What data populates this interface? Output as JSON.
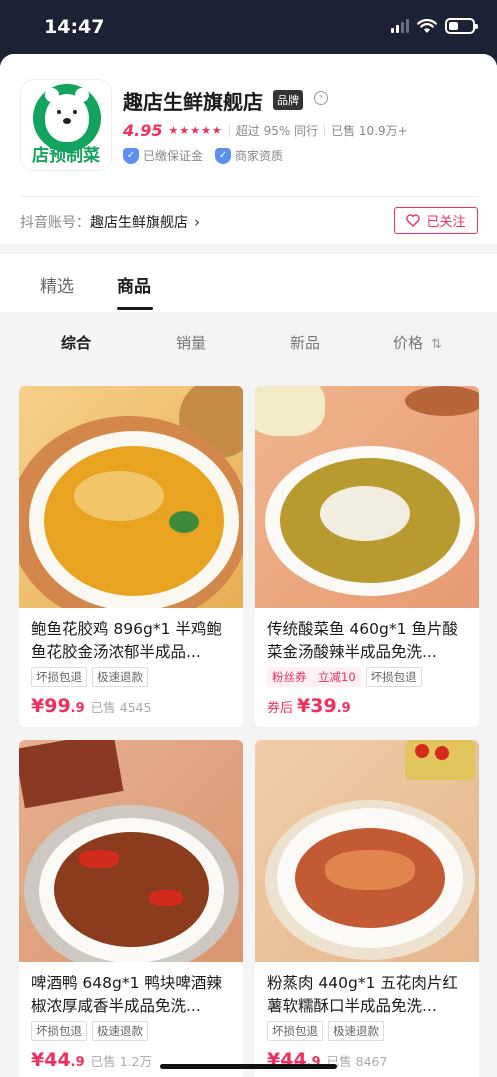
{
  "status": {
    "time": "14:47"
  },
  "shop": {
    "logo_text": "店预制菜",
    "name": "趣店生鲜旗舰店",
    "brand_badge": "品牌",
    "rating": "4.95",
    "beat_rate": "超过 95% 同行",
    "sold": "已售 10.9万+",
    "cert1": "已缴保证金",
    "cert2": "商家资质",
    "account_label": "抖音账号：",
    "account_value": "趣店生鲜旗舰店",
    "follow_label": "已关注"
  },
  "tabs": [
    "精选",
    "商品"
  ],
  "filters": [
    "综合",
    "销量",
    "新品",
    "价格"
  ],
  "colors": {
    "accent": "#f22f5c",
    "brand_green": "#12a35d"
  },
  "products": [
    {
      "title": "鲍鱼花胶鸡 896g*1 半鸡鲍鱼花胶金汤浓郁半成品...",
      "tags": [
        "坏损包退",
        "极速退款"
      ],
      "price_prefix": "",
      "price_main": "¥99",
      "price_dec": ".9",
      "sold": "已售 4545"
    },
    {
      "title": "传统酸菜鱼 460g*1 鱼片酸菜金汤酸辣半成品免洗...",
      "tags": [
        "粉丝券　立减10",
        "坏损包退"
      ],
      "price_prefix": "券后",
      "price_main": "¥39",
      "price_dec": ".9",
      "sold": ""
    },
    {
      "title": "啤酒鸭 648g*1 鸭块啤酒辣椒浓厚咸香半成品免洗...",
      "tags": [
        "坏损包退",
        "极速退款"
      ],
      "price_prefix": "",
      "price_main": "¥44",
      "price_dec": ".9",
      "sold": "已售 1.2万"
    },
    {
      "title": "粉蒸肉 440g*1 五花肉片红薯软糯酥口半成品免洗...",
      "tags": [
        "坏损包退",
        "极速退款"
      ],
      "price_prefix": "",
      "price_main": "¥44",
      "price_dec": ".9",
      "sold": "已售 8467"
    }
  ]
}
